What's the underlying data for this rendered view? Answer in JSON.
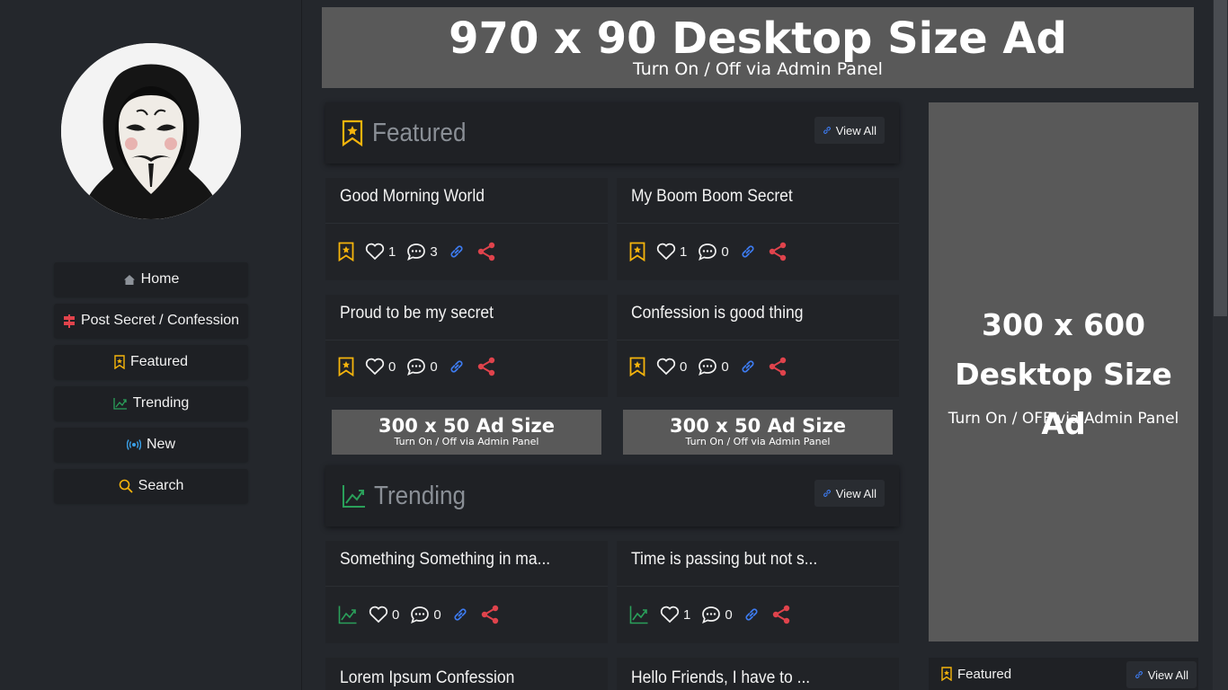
{
  "sidebar": {
    "nav": [
      {
        "label": "Home",
        "icon": "home-icon"
      },
      {
        "label": "Post Secret / Confession",
        "icon": "signpost-icon"
      },
      {
        "label": "Featured",
        "icon": "bookmark-star-icon"
      },
      {
        "label": "Trending",
        "icon": "trending-icon"
      },
      {
        "label": "New",
        "icon": "broadcast-icon"
      },
      {
        "label": "Search",
        "icon": "search-icon"
      }
    ]
  },
  "ads": {
    "top": {
      "title": "970 x 90 Desktop Size Ad",
      "subtitle": "Turn On / Off via Admin Panel"
    },
    "small_left": {
      "title": "300 x 50 Ad Size",
      "subtitle": "Turn On / Off via Admin Panel"
    },
    "small_right": {
      "title": "300 x 50 Ad Size",
      "subtitle": "Turn On / Off via Admin Panel"
    },
    "right": {
      "title_line1": "300 x 600",
      "title_line2": "Desktop Size Ad",
      "subtitle": "Turn On / OFF via Admin Panel"
    }
  },
  "featured": {
    "title": "Featured",
    "view_all": "View All",
    "posts": [
      {
        "title": "Good Morning World",
        "likes": "1",
        "comments": "3"
      },
      {
        "title": "My Boom Boom Secret",
        "likes": "1",
        "comments": "0"
      },
      {
        "title": "Proud to be my secret",
        "likes": "0",
        "comments": "0"
      },
      {
        "title": "Confession is good thing",
        "likes": "0",
        "comments": "0"
      }
    ]
  },
  "trending": {
    "title": "Trending",
    "view_all": "View All",
    "posts": [
      {
        "title": "Something Something in ma...",
        "likes": "0",
        "comments": "0"
      },
      {
        "title": "Time is passing but not s...",
        "likes": "1",
        "comments": "0"
      },
      {
        "title": "Lorem Ipsum Confession"
      },
      {
        "title": "Hello Friends, I have to ..."
      }
    ]
  },
  "right_sidebar": {
    "featured_title": "Featured",
    "view_all": "View All"
  },
  "colors": {
    "accent_yellow": "#f5b40c",
    "accent_green": "#2aa05a",
    "link_blue": "#3d7bf0",
    "share_red": "#e0434c",
    "ad_gray": "#595959"
  }
}
